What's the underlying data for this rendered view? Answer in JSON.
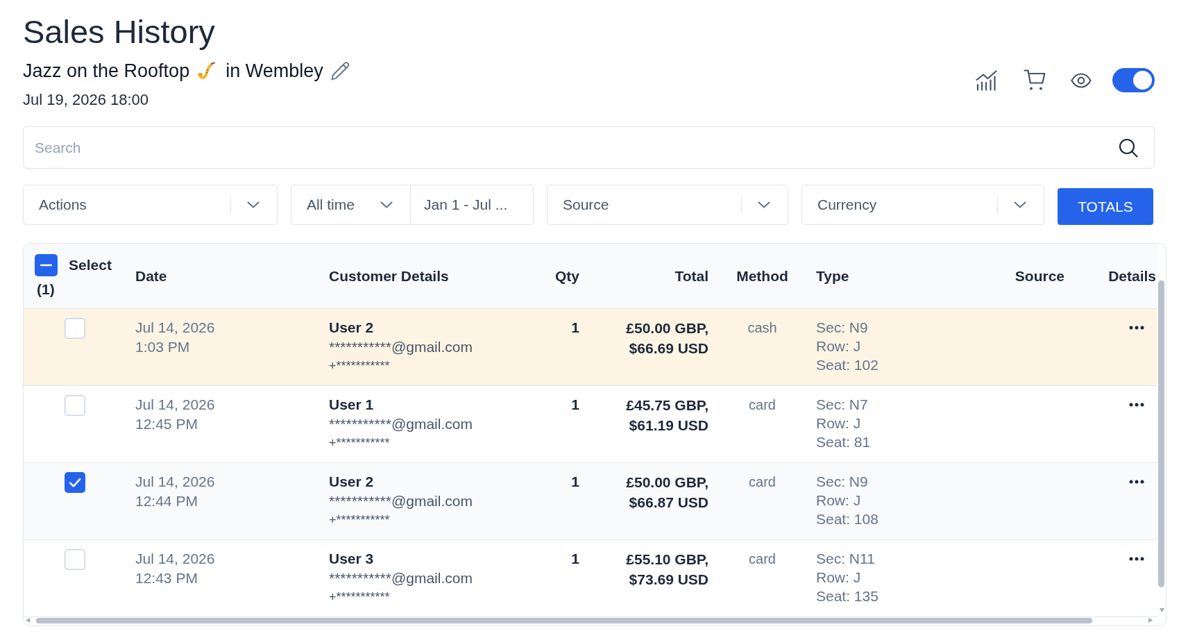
{
  "page": {
    "title": "Sales History"
  },
  "event": {
    "name": "Jazz on the Rooftop",
    "venue": "in Wembley",
    "date": "Jul 19, 2026 18:00"
  },
  "header_toggle": {
    "on": true
  },
  "search": {
    "placeholder": "Search"
  },
  "filters": [
    {
      "kind": "select",
      "label": "Actions"
    },
    {
      "kind": "period",
      "label": "All time",
      "range": "Jan 1 - Jul ..."
    },
    {
      "kind": "select",
      "label": "Source"
    },
    {
      "kind": "select",
      "label": "Currency"
    },
    {
      "kind": "button",
      "label": "TOTALS"
    }
  ],
  "table": {
    "select_all": {
      "label": "Select",
      "count": "(1)",
      "indeterminate": true
    },
    "columns": [
      "Date",
      "Customer Details",
      "Qty",
      "Total",
      "Method",
      "Type",
      "Source",
      "Details"
    ],
    "rows": [
      {
        "selected": false,
        "highlighted": true,
        "date": "Jul 14, 2026",
        "time": "1:03 PM",
        "customer": {
          "name": "User 2",
          "email": "***********@gmail.com",
          "phone": "+***********"
        },
        "qty": "1",
        "total": "£50.00 GBP, $66.69 USD",
        "method": "cash",
        "type": [
          "Sec: N9",
          "Row: J",
          "Seat: 102"
        ]
      },
      {
        "selected": false,
        "highlighted": false,
        "date": "Jul 14, 2026",
        "time": "12:45 PM",
        "customer": {
          "name": "User 1",
          "email": "***********@gmail.com",
          "phone": "+***********"
        },
        "qty": "1",
        "total": "£45.75 GBP, $61.19 USD",
        "method": "card",
        "type": [
          "Sec: N7",
          "Row: J",
          "Seat: 81"
        ]
      },
      {
        "selected": true,
        "highlighted": false,
        "date": "Jul 14, 2026",
        "time": "12:44 PM",
        "customer": {
          "name": "User 2",
          "email": "***********@gmail.com",
          "phone": "+***********"
        },
        "qty": "1",
        "total": "£50.00 GBP, $66.87 USD",
        "method": "card",
        "type": [
          "Sec: N9",
          "Row: J",
          "Seat: 108"
        ]
      },
      {
        "selected": false,
        "highlighted": false,
        "date": "Jul 14, 2026",
        "time": "12:43 PM",
        "customer": {
          "name": "User 3",
          "email": "***********@gmail.com",
          "phone": "+***********"
        },
        "qty": "1",
        "total": "£55.10 GBP, $73.69 USD",
        "method": "card",
        "type": [
          "Sec: N11",
          "Row: J",
          "Seat: 135"
        ]
      }
    ]
  }
}
